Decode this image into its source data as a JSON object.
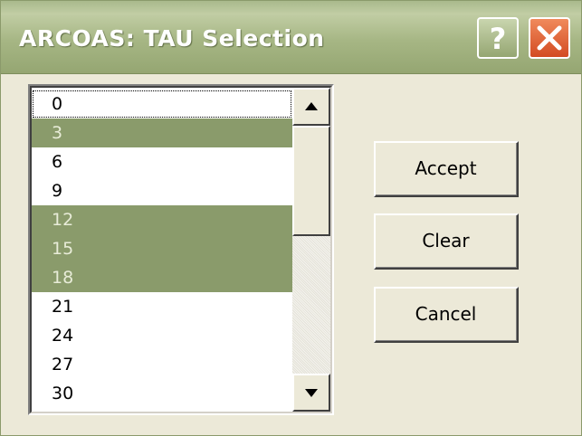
{
  "window": {
    "title": "ARCOAS:  TAU Selection"
  },
  "titlebar": {
    "help_icon": "help-icon",
    "close_icon": "close-icon"
  },
  "colors": {
    "titlebar": "#a6b684",
    "selection": "#8a9b6b",
    "close": "#d34b22",
    "face": "#ece9d8"
  },
  "list": {
    "items": [
      {
        "label": "0",
        "selected": false,
        "focused": true
      },
      {
        "label": "3",
        "selected": true
      },
      {
        "label": "6",
        "selected": false
      },
      {
        "label": "9",
        "selected": false
      },
      {
        "label": "12",
        "selected": true
      },
      {
        "label": "15",
        "selected": true
      },
      {
        "label": "18",
        "selected": true
      },
      {
        "label": "21",
        "selected": false
      },
      {
        "label": "24",
        "selected": false
      },
      {
        "label": "27",
        "selected": false
      },
      {
        "label": "30",
        "selected": false
      }
    ]
  },
  "buttons": {
    "accept": "Accept",
    "clear": "Clear",
    "cancel": "Cancel"
  }
}
